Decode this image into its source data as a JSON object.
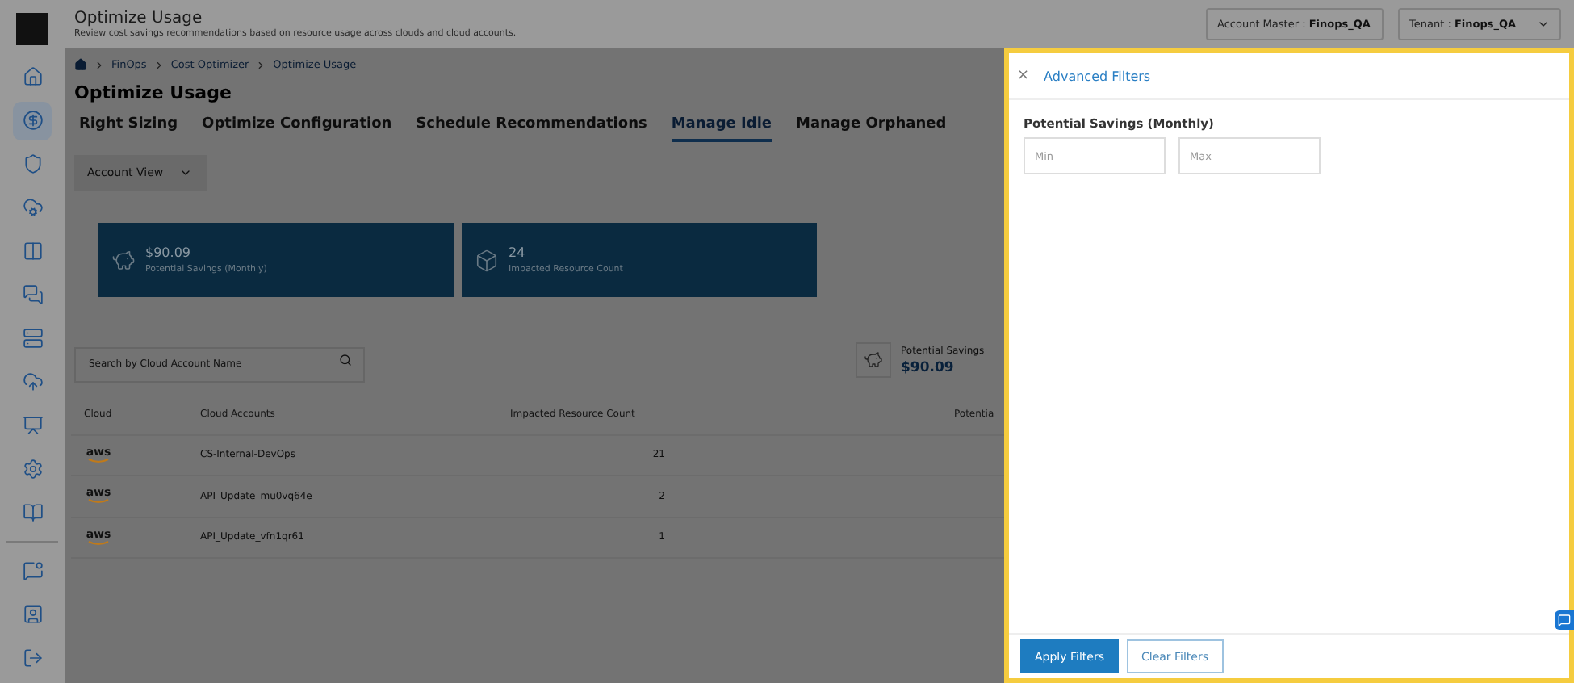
{
  "header": {
    "title": "Optimize Usage",
    "subtitle": "Review cost savings recommendations based on resource usage across clouds and cloud accounts.",
    "selectors": [
      {
        "label": "Account Master : ",
        "value": "Finops_QA"
      },
      {
        "label": "Tenant : ",
        "value": "Finops_QA"
      }
    ]
  },
  "sidebar": {
    "items": [
      {
        "selected": false
      },
      {
        "selected": true
      },
      {
        "selected": false
      },
      {
        "selected": false
      },
      {
        "selected": false
      },
      {
        "selected": false
      },
      {
        "selected": false
      },
      {
        "selected": false
      },
      {
        "selected": false
      },
      {
        "selected": false
      },
      {
        "selected": false
      }
    ]
  },
  "breadcrumb": [
    "FinOps",
    "Cost Optimizer",
    "Optimize Usage"
  ],
  "page_title": "Optimize Usage",
  "tabs": [
    {
      "label": "Right Sizing",
      "selected": false
    },
    {
      "label": "Optimize Configuration",
      "selected": false
    },
    {
      "label": "Schedule Recommendations",
      "selected": false
    },
    {
      "label": "Manage Idle",
      "selected": true
    },
    {
      "label": "Manage Orphaned",
      "selected": false
    }
  ],
  "view_dropdown": "Account View",
  "cards": [
    {
      "value": "$90.09",
      "label": "Potential Savings (Monthly)"
    },
    {
      "value": "24",
      "label": "Impacted Resource Count"
    }
  ],
  "search": {
    "placeholder": "Search by Cloud Account Name"
  },
  "summary": {
    "label": "Potential Savings",
    "value": "$90.09"
  },
  "table": {
    "columns": [
      "Cloud",
      "Cloud Accounts",
      "Impacted Resource Count",
      "Potentia"
    ],
    "rows": [
      {
        "cloud": "aws",
        "account": "CS-Internal-DevOps",
        "count": "21"
      },
      {
        "cloud": "aws",
        "account": "API_Update_mu0vq64e",
        "count": "2"
      },
      {
        "cloud": "aws",
        "account": "API_Update_vfn1qr61",
        "count": "1"
      }
    ]
  },
  "drawer": {
    "close": "×",
    "title": "Advanced Filters",
    "section": "Potential Savings (Monthly)",
    "fields": [
      {
        "placeholder": "Min"
      },
      {
        "placeholder": "Max"
      }
    ],
    "buttons": [
      {
        "label": "Apply Filters",
        "kind": "primary"
      },
      {
        "label": "Clear Filters",
        "kind": "outline"
      }
    ]
  }
}
